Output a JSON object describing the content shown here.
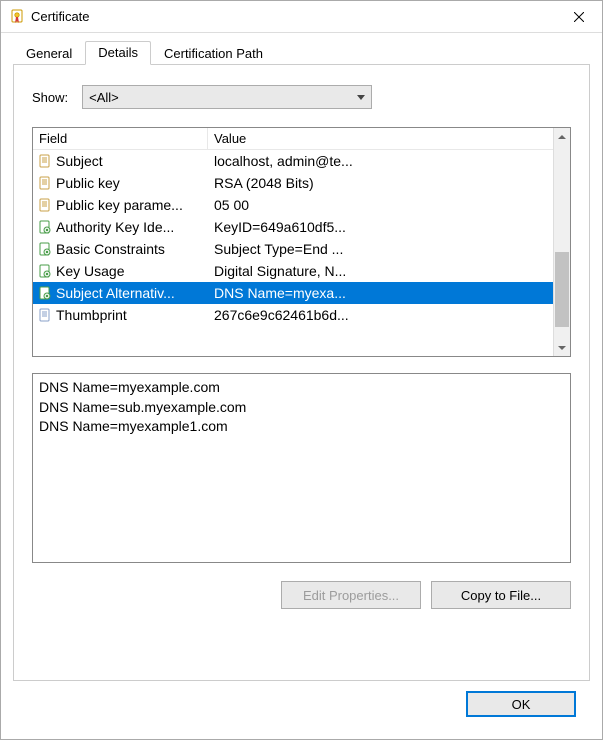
{
  "window": {
    "title": "Certificate"
  },
  "tabs": [
    {
      "label": "General",
      "active": false
    },
    {
      "label": "Details",
      "active": true
    },
    {
      "label": "Certification Path",
      "active": false
    }
  ],
  "show": {
    "label": "Show:",
    "value": "<All>"
  },
  "list": {
    "columns": {
      "field": "Field",
      "value": "Value"
    },
    "rows": [
      {
        "icon": "doc",
        "field": "Subject",
        "value": "localhost, admin@te..."
      },
      {
        "icon": "doc",
        "field": "Public key",
        "value": "RSA (2048 Bits)"
      },
      {
        "icon": "doc",
        "field": "Public key parame...",
        "value": "05 00"
      },
      {
        "icon": "ext",
        "field": "Authority Key Ide...",
        "value": "KeyID=649a610df5..."
      },
      {
        "icon": "ext",
        "field": "Basic Constraints",
        "value": "Subject Type=End ..."
      },
      {
        "icon": "ext",
        "field": "Key Usage",
        "value": "Digital Signature, N..."
      },
      {
        "icon": "ext",
        "field": "Subject Alternativ...",
        "value": "DNS Name=myexa...",
        "selected": true
      },
      {
        "icon": "prop",
        "field": "Thumbprint",
        "value": "267c6e9c62461b6d..."
      }
    ]
  },
  "detail_text": "DNS Name=myexample.com\nDNS Name=sub.myexample.com\nDNS Name=myexample1.com",
  "buttons": {
    "edit_properties": "Edit Properties...",
    "copy_to_file": "Copy to File...",
    "ok": "OK"
  }
}
